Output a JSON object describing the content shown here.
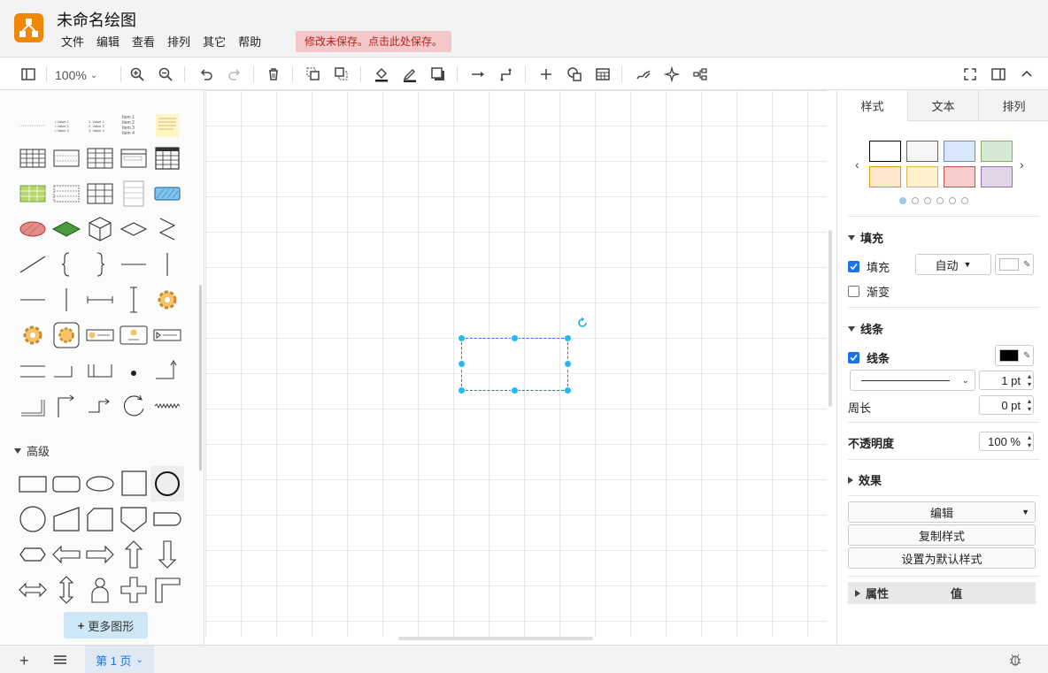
{
  "app": {
    "title": "未命名绘图",
    "unsaved_notice": "修改未保存。点击此处保存。",
    "menu": [
      "文件",
      "编辑",
      "查看",
      "排列",
      "其它",
      "帮助"
    ]
  },
  "toolbar": {
    "zoom": "100%",
    "icons": [
      "format-panel-icon",
      "zoom-in-icon",
      "zoom-out-icon",
      "undo-icon",
      "redo-icon",
      "delete-icon",
      "to-front-icon",
      "to-back-icon",
      "fill-color-icon",
      "line-color-icon",
      "shadow-icon",
      "connection-icon",
      "waypoints-icon",
      "insert-icon",
      "shapes-icon",
      "table-icon",
      "freehand-icon",
      "magic-icon",
      "layout-icon",
      "fullscreen-icon",
      "sidebar-toggle-icon",
      "collapse-icon"
    ]
  },
  "sidebar": {
    "section_title": "高级",
    "more_shapes": "更多图形",
    "preview_text": {
      "list1": [
        "• Value 1",
        "• Value 2",
        "• Value 3"
      ],
      "list2": [
        "1. Value 1",
        "2. Value 2",
        "3. Value 3"
      ],
      "items": [
        "Item 1",
        "Item 2",
        "Item 3",
        "Item 4"
      ]
    }
  },
  "format_panel": {
    "tabs": [
      "样式",
      "文本",
      "排列"
    ],
    "swatches": [
      "#ffffff",
      "#f5f5f5",
      "#dae8fc",
      "#d5e8d4",
      "#ffe6cc",
      "#fff2cc",
      "#f8cecc",
      "#e1d5e7"
    ],
    "swatch_borders": [
      "#000000",
      "#666666",
      "#6c8ebf",
      "#82b366",
      "#d79b00",
      "#d6b656",
      "#b85450",
      "#9673a6"
    ],
    "fill_section": "填充",
    "fill_label": "填充",
    "fill_mode": "自动",
    "gradient_label": "渐变",
    "line_section": "线条",
    "line_label": "线条",
    "line_width": "1 pt",
    "perimeter_label": "周长",
    "perimeter_value": "0 pt",
    "opacity_label": "不透明度",
    "opacity_value": "100 %",
    "effects_label": "效果",
    "edit_label": "编辑",
    "copy_style": "复制样式",
    "set_default": "设置为默认样式",
    "properties_col": "属性",
    "value_col": "值"
  },
  "footer": {
    "page_tab": "第 1 页"
  }
}
